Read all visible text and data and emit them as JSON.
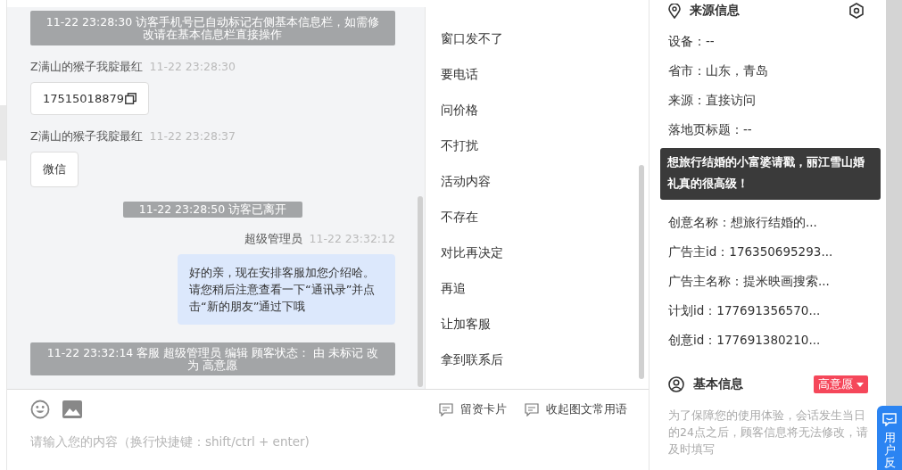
{
  "chat": {
    "messages": [
      {
        "kind": "system",
        "text": "11-22 23:28:30 访客手机号已自动标记右侧基本信息栏，如需修改请在基本信息栏直接操作"
      },
      {
        "kind": "visitor",
        "sender": "Z满山的猴子我腚最红",
        "time": "11-22 23:28:30",
        "text": "17515018879",
        "copyable": true
      },
      {
        "kind": "visitor",
        "sender": "Z满山的猴子我腚最红",
        "time": "11-22 23:28:37",
        "text": "微信",
        "copyable": false
      },
      {
        "kind": "system",
        "text": "11-22 23:28:50 访客已离开"
      },
      {
        "kind": "agent",
        "sender": "超级管理员",
        "time": "11-22 23:32:12",
        "text": "好的亲，现在安排客服加您介绍哈。请您稍后注意查看一下“通讯录”并点击“新的朋友”通过下哦"
      },
      {
        "kind": "system",
        "text": "11-22 23:32:14 客服 超级管理员 编辑 顾客状态： 由 未标记 改为 高意愿"
      }
    ]
  },
  "quick_replies": {
    "items": [
      "窗口发不了",
      "要电话",
      "问价格",
      "不打扰",
      "活动内容",
      "不存在",
      "对比再决定",
      "再追",
      "让加客服",
      "拿到联系后"
    ]
  },
  "composer": {
    "placeholder": "请输入您的内容（换行快捷键：shift/ctrl + enter)",
    "actions": [
      {
        "label": "留资卡片"
      },
      {
        "label": "收起图文常用语"
      }
    ]
  },
  "source_info": {
    "title": "来源信息",
    "rows": [
      {
        "kind": "field",
        "text": "设备：--"
      },
      {
        "kind": "field",
        "text": "省市：山东，青岛"
      },
      {
        "kind": "field",
        "text": "来源：直接访问"
      },
      {
        "kind": "field",
        "text": "落地页标题：--"
      },
      {
        "kind": "tooltip",
        "text": "想旅行结婚的小富婆请戳，丽江雪山婚礼真的很高级！"
      },
      {
        "kind": "field",
        "text": "创意名称：想旅行结婚的..."
      },
      {
        "kind": "field",
        "text": "广告主id：176350695293..."
      },
      {
        "kind": "field",
        "text": "广告主名称：提米映画搜索..."
      },
      {
        "kind": "field",
        "text": "计划id：177691356570..."
      },
      {
        "kind": "field",
        "text": "创意id：177691380210..."
      }
    ]
  },
  "basic_info": {
    "title": "基本信息",
    "status": "高意愿",
    "notice": "为了保障您的使用体验，会话发生当日的24点之后，顾客信息将无法修改，请及时填写"
  },
  "feedback_button": {
    "label": "用户反"
  }
}
